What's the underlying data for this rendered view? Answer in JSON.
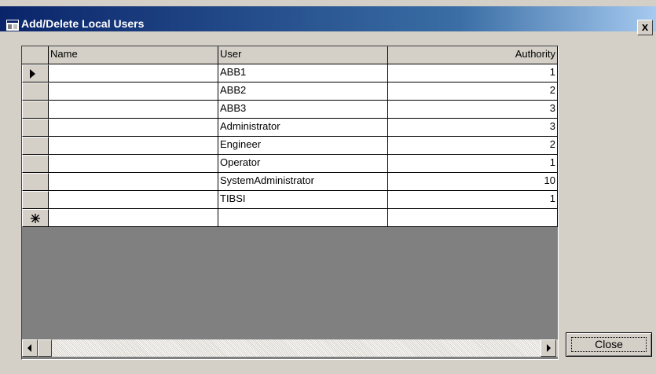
{
  "window": {
    "title": "Add/Delete Local Users",
    "close_glyph": "x"
  },
  "grid": {
    "columns": [
      "Name",
      "User",
      "Authority"
    ],
    "rows": [
      {
        "name": "",
        "user": "ABB1",
        "authority": "1"
      },
      {
        "name": "",
        "user": "ABB2",
        "authority": "2"
      },
      {
        "name": "",
        "user": "ABB3",
        "authority": "3"
      },
      {
        "name": "",
        "user": "Administrator",
        "authority": "3"
      },
      {
        "name": "",
        "user": "Engineer",
        "authority": "2"
      },
      {
        "name": "",
        "user": "Operator",
        "authority": "1"
      },
      {
        "name": "",
        "user": "SystemAdministrator",
        "authority": "10"
      },
      {
        "name": "",
        "user": "TIBSI",
        "authority": "1"
      }
    ],
    "current_row_icon": "current-row-arrow-icon",
    "new_row_icon": "new-row-asterisk-icon"
  },
  "buttons": {
    "close_label": "Close"
  }
}
